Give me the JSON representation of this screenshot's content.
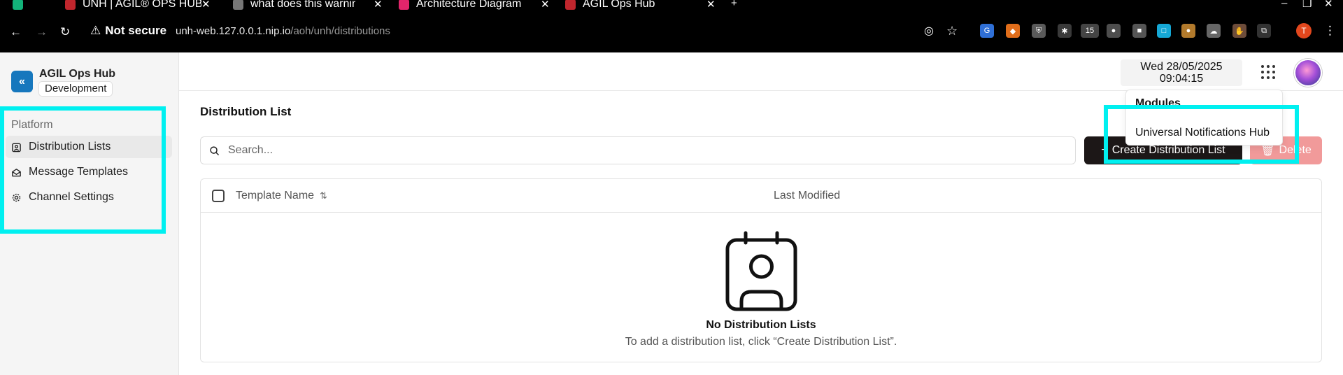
{
  "browser": {
    "tabs": [
      {
        "title": "UNH | AGIL® OPS HUB",
        "favicon_color": "#c0262d"
      },
      {
        "title": "what does this warning",
        "favicon_color": "#777777"
      },
      {
        "title": "Architecture Diagram",
        "favicon_color": "#e3256b"
      },
      {
        "title": "AGIL Ops Hub",
        "favicon_color": "#c0262d"
      }
    ],
    "security_label": "Not secure",
    "url_host": "unh-web.127.0.0.1.nip.io",
    "url_path": "/aoh/unh/distributions",
    "extension_badge": "15",
    "profile_initial": "T"
  },
  "app": {
    "name": "AGIL Ops Hub",
    "environment": "Development",
    "logo_glyph": "«"
  },
  "sidebar": {
    "section_label": "Platform",
    "items": [
      {
        "label": "Distribution Lists",
        "icon": "contact-card-icon",
        "active": true
      },
      {
        "label": "Message Templates",
        "icon": "envelope-open-icon",
        "active": false
      },
      {
        "label": "Channel Settings",
        "icon": "gear-icon",
        "active": false
      }
    ]
  },
  "header": {
    "date": "Wed 28/05/2025",
    "time": "09:04:15"
  },
  "modules_menu": {
    "heading": "Modules",
    "items": [
      "Universal Notifications Hub"
    ]
  },
  "main": {
    "title": "Distribution List",
    "search_placeholder": "Search...",
    "create_label": "Create Distribution List",
    "delete_label": "Delete",
    "columns": [
      "Template Name",
      "Last Modified"
    ],
    "empty_title": "No Distribution Lists",
    "empty_message": "To add a distribution list, click “Create Distribution List”."
  },
  "colors": {
    "accent": "#1677bd",
    "highlight": "#00f0f0",
    "delete": "#f19a9a",
    "primary_button": "#1c1717"
  }
}
